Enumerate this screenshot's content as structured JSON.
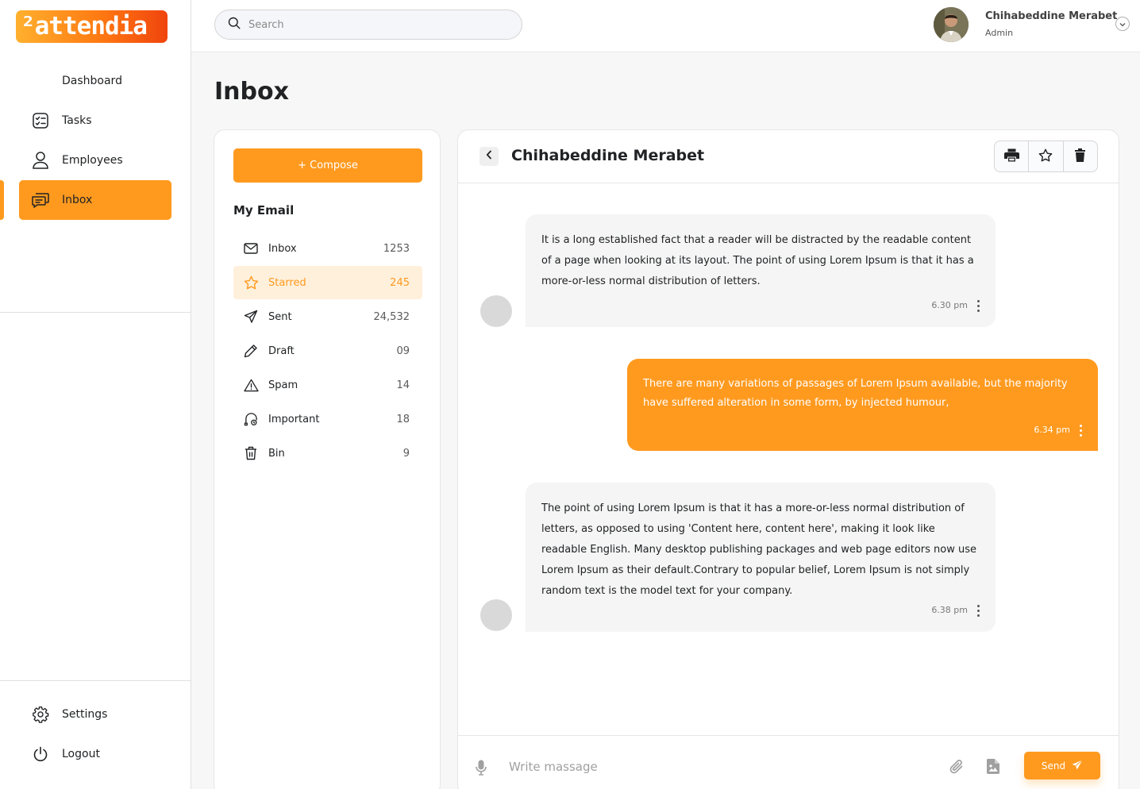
{
  "brand": {
    "logo_text": "²attendia",
    "accent": "#ff9a1f"
  },
  "sidebar": {
    "items": [
      {
        "label": "Dashboard",
        "icon": "dashboard-icon"
      },
      {
        "label": "Tasks",
        "icon": "tasks-icon"
      },
      {
        "label": "Employees",
        "icon": "user-icon"
      },
      {
        "label": "Inbox",
        "icon": "inbox-icon",
        "active": true
      }
    ],
    "bottom": [
      {
        "label": "Settings",
        "icon": "gear-icon"
      },
      {
        "label": "Logout",
        "icon": "power-icon"
      }
    ]
  },
  "header": {
    "search_placeholder": "Search",
    "user": {
      "name": "Chihabeddine Merabet",
      "role": "Admin"
    }
  },
  "page": {
    "title": "Inbox"
  },
  "mail": {
    "compose_label": "+ Compose",
    "section_title": "My Email",
    "folders": [
      {
        "label": "Inbox",
        "count": "1253",
        "icon": "mail-icon"
      },
      {
        "label": "Starred",
        "count": "245",
        "icon": "star-icon",
        "active": true
      },
      {
        "label": "Sent",
        "count": "24,532",
        "icon": "send-icon"
      },
      {
        "label": "Draft",
        "count": "09",
        "icon": "pencil-icon"
      },
      {
        "label": "Spam",
        "count": "14",
        "icon": "warning-icon"
      },
      {
        "label": "Important",
        "count": "18",
        "icon": "important-icon"
      },
      {
        "label": "Bin",
        "count": "9",
        "icon": "trash-icon"
      }
    ]
  },
  "conversation": {
    "contact_name": "Chihabeddine Merabet",
    "messages": [
      {
        "direction": "incoming",
        "text": "It is a long established fact that a reader will be distracted by the readable content of a page when looking at its layout. The point of using Lorem Ipsum is that it has a more-or-less normal distribution of letters.",
        "time": "6.30 pm"
      },
      {
        "direction": "outgoing",
        "text": "There are many variations of passages of Lorem Ipsum available, but the majority have suffered alteration in some form, by injected humour,",
        "time": "6.34 pm"
      },
      {
        "direction": "incoming",
        "text": "The point of using Lorem Ipsum is that it has a more-or-less normal distribution of letters, as opposed to using 'Content here, content here', making it look like readable English. Many desktop publishing packages and web page editors now use Lorem Ipsum as their default.Contrary to popular belief, Lorem Ipsum is not simply random text is the model text for your company.",
        "time": "6.38 pm"
      }
    ],
    "composer": {
      "placeholder": "Write massage",
      "send_label": "Send"
    }
  }
}
